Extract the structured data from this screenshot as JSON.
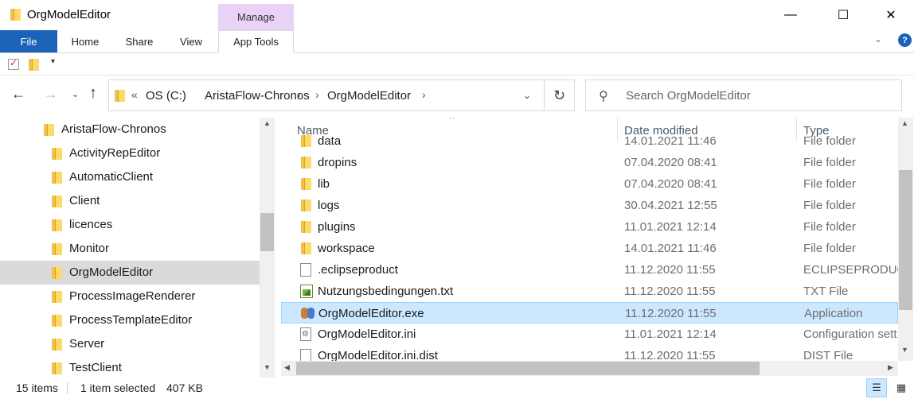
{
  "window": {
    "title": "OrgModelEditor",
    "minimize_glyph": "—",
    "maximize_glyph": "☐",
    "close_glyph": "✕"
  },
  "ribbon": {
    "contextual_group": "Manage",
    "tabs": [
      {
        "label": "File"
      },
      {
        "label": "Home"
      },
      {
        "label": "Share"
      },
      {
        "label": "View"
      },
      {
        "label": "App Tools"
      }
    ],
    "help_glyph": "?",
    "expand_glyph": "⌄"
  },
  "quick_access": {
    "dropdown_glyph": "▾"
  },
  "navigation": {
    "back_glyph": "←",
    "forward_glyph": "→",
    "recent_glyph": "⌄",
    "up_glyph": "↑"
  },
  "address": {
    "overflow_glyph": "«",
    "separator_glyph": "›",
    "breadcrumbs": [
      "OS (C:)",
      "AristaFlow-Chronos",
      "OrgModelEditor"
    ],
    "dropdown_glyph": "⌄",
    "refresh_glyph": "↻"
  },
  "search": {
    "icon_glyph": "⚲",
    "placeholder": "Search OrgModelEditor"
  },
  "nav_tree": {
    "items": [
      {
        "label": "AristaFlow-Chronos",
        "selected": false,
        "indent": 0
      },
      {
        "label": "ActivityRepEditor",
        "selected": false,
        "indent": 1
      },
      {
        "label": "AutomaticClient",
        "selected": false,
        "indent": 1
      },
      {
        "label": "Client",
        "selected": false,
        "indent": 1
      },
      {
        "label": "licences",
        "selected": false,
        "indent": 1
      },
      {
        "label": "Monitor",
        "selected": false,
        "indent": 1
      },
      {
        "label": "OrgModelEditor",
        "selected": true,
        "indent": 1
      },
      {
        "label": "ProcessImageRenderer",
        "selected": false,
        "indent": 1
      },
      {
        "label": "ProcessTemplateEditor",
        "selected": false,
        "indent": 1
      },
      {
        "label": "Server",
        "selected": false,
        "indent": 1
      },
      {
        "label": "TestClient",
        "selected": false,
        "indent": 1
      }
    ]
  },
  "file_list": {
    "columns": {
      "name": "Name",
      "date": "Date modified",
      "type": "Type"
    },
    "sort_glyph": "^",
    "rows": [
      {
        "icon": "folder-icon",
        "name": "data",
        "date": "14.01.2021 11:46",
        "type": "File folder",
        "selected": false
      },
      {
        "icon": "folder-icon",
        "name": "dropins",
        "date": "07.04.2020 08:41",
        "type": "File folder",
        "selected": false
      },
      {
        "icon": "folder-icon",
        "name": "lib",
        "date": "07.04.2020 08:41",
        "type": "File folder",
        "selected": false
      },
      {
        "icon": "folder-icon",
        "name": "logs",
        "date": "30.04.2021 12:55",
        "type": "File folder",
        "selected": false
      },
      {
        "icon": "folder-icon",
        "name": "plugins",
        "date": "11.01.2021 12:14",
        "type": "File folder",
        "selected": false
      },
      {
        "icon": "folder-icon",
        "name": "workspace",
        "date": "14.01.2021 11:46",
        "type": "File folder",
        "selected": false
      },
      {
        "icon": "document-icon",
        "name": ".eclipseproduct",
        "date": "11.12.2020 11:55",
        "type": "ECLIPSEPRODUCT",
        "selected": false
      },
      {
        "icon": "text-file-icon",
        "name": "Nutzungsbedingungen.txt",
        "date": "11.12.2020 11:55",
        "type": "TXT File",
        "selected": false
      },
      {
        "icon": "application-icon",
        "name": "OrgModelEditor.exe",
        "date": "11.12.2020 11:55",
        "type": "Application",
        "selected": true
      },
      {
        "icon": "settings-file-icon",
        "name": "OrgModelEditor.ini",
        "date": "11.01.2021 12:14",
        "type": "Configuration sett",
        "selected": false
      },
      {
        "icon": "document-icon",
        "name": "OrgModelEditor.ini.dist",
        "date": "11.12.2020 11:55",
        "type": "DIST File",
        "selected": false
      }
    ]
  },
  "scroll_glyphs": {
    "up": "▲",
    "down": "▼",
    "left": "◀",
    "right": "▶"
  },
  "status": {
    "item_count": "15 items",
    "selection": "1 item selected",
    "size": "407 KB",
    "details_view_glyph": "☰",
    "tiles_view_glyph": "▦"
  },
  "colors": {
    "file_tab": "#1a63b8",
    "manage_tab": "#e9d2f5",
    "selection": "#cce8ff",
    "nav_selection": "#dadada"
  }
}
